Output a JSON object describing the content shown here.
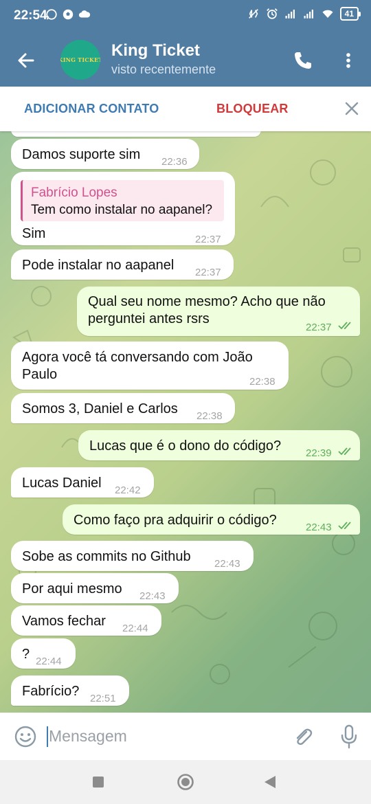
{
  "status_bar": {
    "time": "22:54",
    "battery": "41"
  },
  "header": {
    "title": "King Ticket",
    "subtitle": "visto recentemente",
    "avatar_text": "KING TICKET",
    "bg_color": "#517DA2"
  },
  "action_bar": {
    "add_contact": "ADICIONAR CONTATO",
    "block": "BLOQUEAR"
  },
  "messages": [
    {
      "dir": "in",
      "text": "Damos suporte sim",
      "time": "22:36"
    },
    {
      "dir": "in",
      "reply_name": "Fabrício Lopes",
      "reply_text": "Tem como instalar no aapanel?",
      "text": "Sim",
      "time": "22:37"
    },
    {
      "dir": "in",
      "text": "Pode instalar no aapanel",
      "time": "22:37"
    },
    {
      "dir": "out",
      "text1": "Qual seu nome mesmo? Acho que não",
      "text2": "perguntei antes rsrs",
      "time": "22:37"
    },
    {
      "dir": "in",
      "text1": "Agora você tá conversando com João",
      "text2": "Paulo",
      "time": "22:38"
    },
    {
      "dir": "in",
      "text": "Somos 3, Daniel e Carlos",
      "time": "22:38"
    },
    {
      "dir": "out",
      "text": "Lucas que é o dono do código?",
      "time": "22:39"
    },
    {
      "dir": "in",
      "text": "Lucas Daniel",
      "time": "22:42"
    },
    {
      "dir": "out",
      "text": "Como faço pra adquirir o código?",
      "time": "22:43"
    },
    {
      "dir": "in",
      "text": "Sobe as commits no Github",
      "time": "22:43"
    },
    {
      "dir": "in",
      "text": "Por aqui mesmo",
      "time": "22:43"
    },
    {
      "dir": "in",
      "text": "Vamos fechar",
      "time": "22:44"
    },
    {
      "dir": "in",
      "text": "?",
      "time": "22:44"
    },
    {
      "dir": "in",
      "text": "Fabrício?",
      "time": "22:51"
    }
  ],
  "input": {
    "placeholder": "Mensagem"
  },
  "colors": {
    "outgoing_bubble": "#EFFEDD",
    "incoming_bubble": "#FFFFFF",
    "block_red": "#D03A3A",
    "link_blue": "#3E7BB2"
  },
  "icons": [
    "back-arrow-icon",
    "phone-icon",
    "more-vert-icon",
    "close-icon",
    "emoji-icon",
    "attach-icon",
    "mic-icon",
    "double-check-icon"
  ]
}
